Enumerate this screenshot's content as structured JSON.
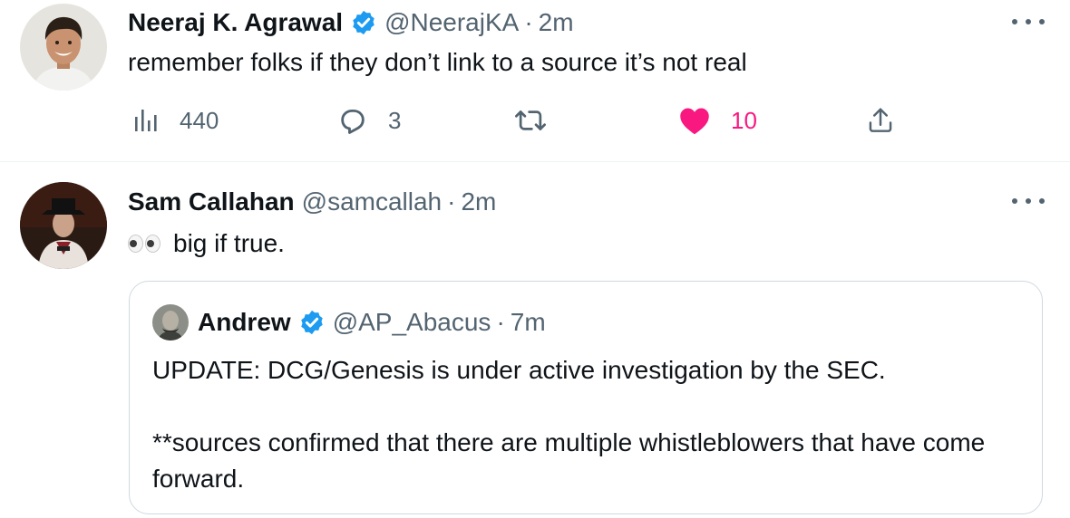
{
  "tweets": [
    {
      "author_name": "Neeraj K. Agrawal",
      "handle": "@NeerajKA",
      "separator": "·",
      "time": "2m",
      "verified": true,
      "text": "remember folks if they don’t link to a source it’s not real",
      "actions": {
        "views": "440",
        "replies": "3",
        "retweets": "",
        "likes": "10",
        "liked": true
      }
    },
    {
      "author_name": "Sam Callahan",
      "handle": "@samcallah",
      "separator": "·",
      "time": "2m",
      "verified": false,
      "emoji": "eyes",
      "text": "big if true.",
      "quote": {
        "author_name": "Andrew",
        "handle": "@AP_Abacus",
        "separator": "·",
        "time": "7m",
        "verified": true,
        "lines": [
          "UPDATE: DCG/Genesis is under active investigation by the SEC.",
          "**sources confirmed that there are multiple whistleblowers that have come forward."
        ]
      }
    }
  ],
  "icons": {
    "views": "views-chart-icon",
    "reply": "reply-bubble-icon",
    "retweet": "retweet-icon",
    "like": "heart-icon",
    "share": "share-upload-icon",
    "verified": "verified-badge-icon",
    "more": "more-options-icon"
  },
  "colors": {
    "text_primary": "#0f1419",
    "text_secondary": "#536471",
    "like_active": "#f91880",
    "verified_blue": "#1d9bf0",
    "divider": "#eff3f4",
    "quote_border": "#cfd9de"
  }
}
